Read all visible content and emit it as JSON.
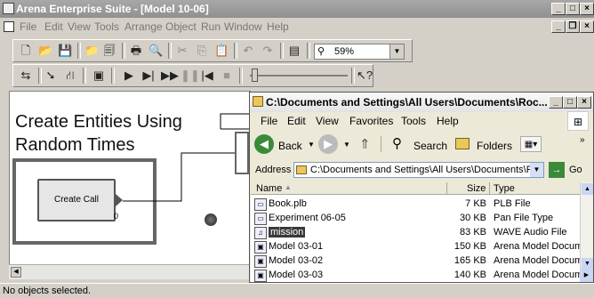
{
  "app": {
    "title": "Arena Enterprise Suite - [Model 10-06]",
    "menu": [
      "File",
      "Edit",
      "View",
      "Tools",
      "Arrange",
      "Object",
      "Run",
      "Window",
      "Help"
    ],
    "zoom": "59%",
    "status": "No objects selected."
  },
  "canvas": {
    "heading_line1": "Create Entities Using",
    "heading_line2": "Random Times",
    "module_label": "Create Call",
    "module_count": "0"
  },
  "explorer": {
    "title": "C:\\Documents and Settings\\All Users\\Documents\\Roc...",
    "menu": [
      "File",
      "Edit",
      "View",
      "Favorites",
      "Tools",
      "Help"
    ],
    "back_label": "Back",
    "search_label": "Search",
    "folders_label": "Folders",
    "address_label": "Address",
    "address_value": "C:\\Documents and Settings\\All Users\\Documents\\R",
    "go_label": "Go",
    "columns": {
      "name": "Name",
      "size": "Size",
      "type": "Type"
    },
    "files": [
      {
        "name": "Book.plb",
        "size": "7 KB",
        "type": "PLB File",
        "icon": "file-icon"
      },
      {
        "name": "Experiment 06-05",
        "size": "30 KB",
        "type": "Pan File Type",
        "icon": "file-icon"
      },
      {
        "name": "mission",
        "size": "83 KB",
        "type": "WAVE Audio File",
        "icon": "audio-file-icon",
        "selected": true
      },
      {
        "name": "Model 03-01",
        "size": "150 KB",
        "type": "Arena Model Docum...",
        "icon": "arena-model-icon"
      },
      {
        "name": "Model 03-02",
        "size": "165 KB",
        "type": "Arena Model Docum...",
        "icon": "arena-model-icon"
      },
      {
        "name": "Model 03-03",
        "size": "140 KB",
        "type": "Arena Model Docum...",
        "icon": "arena-model-icon"
      }
    ]
  }
}
